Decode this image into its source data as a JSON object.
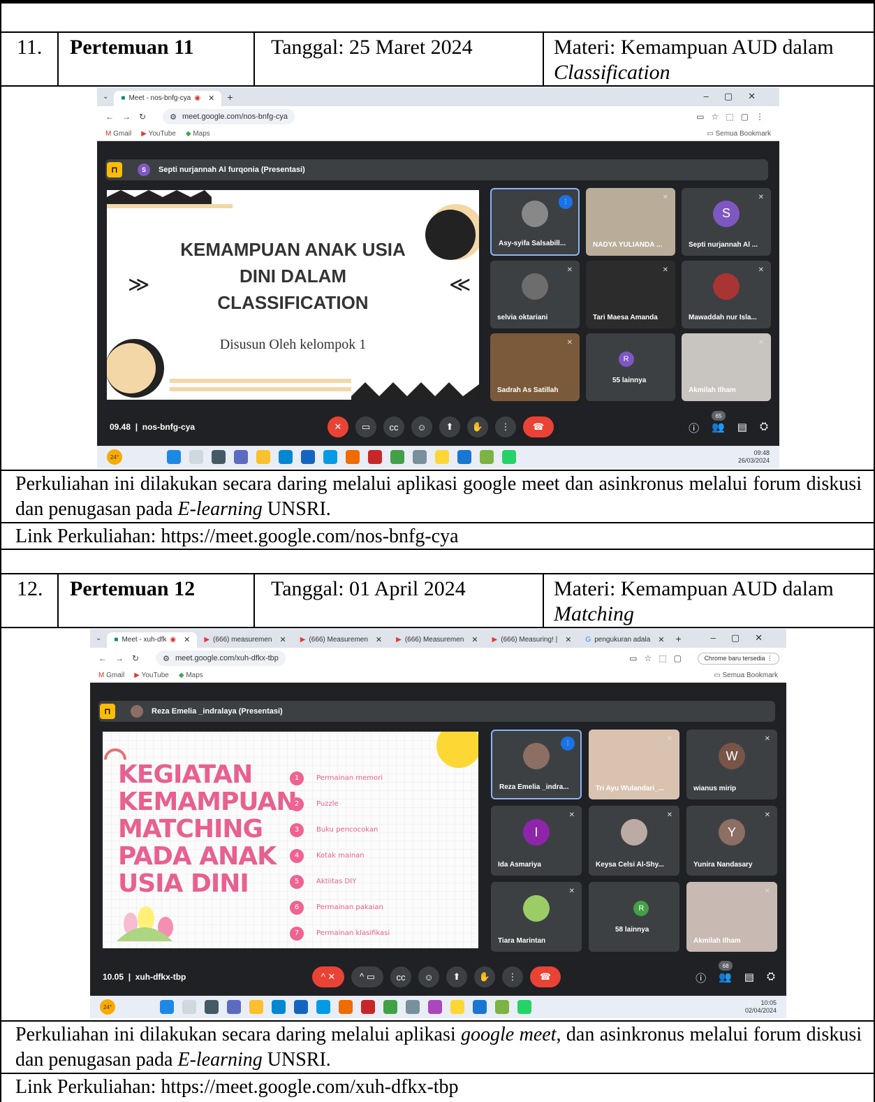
{
  "sessions": [
    {
      "number": "11.",
      "title": "Pertemuan 11",
      "date": "Tanggal: 25 Maret 2024",
      "materi_prefix": "Materi: Kemampuan AUD dalam",
      "materi_topic": "Classification",
      "desc_part1": "Perkuliahan ini dilakukan secara daring melalui aplikasi google meet dan asinkronus melalui forum diskusi dan penugasan pada ",
      "desc_italic": "E-learning",
      "desc_part2": " UNSRI.",
      "link": "Link Perkuliahan: https://meet.google.com/nos-bnfg-cya",
      "screenshot": {
        "tab_title": "Meet - nos-bnfg-cya",
        "url": "meet.google.com/nos-bnfg-cya",
        "bookmarks": [
          "Gmail",
          "YouTube",
          "Maps"
        ],
        "bookmark_folder": "Semua Bookmark",
        "presenter_initial": "S",
        "presenter": "Septi nurjannah Al furqonia (Presentasi)",
        "slide_title_lines": [
          "KEMAMPUAN ANAK USIA",
          "DINI DALAM",
          "CLASSIFICATION"
        ],
        "slide_subtitle": "Disusun Oleh kelompok 1",
        "participants": [
          "Asy-syifa Salsabill...",
          "NADYA YULIANDA ...",
          "Septi nurjannah Al ...",
          "selvia oktariani",
          "Tari Maesa Amanda",
          "Mawaddah nur Isla...",
          "Sadrah As Satillah",
          "55 lainnya",
          "Akmilah Ilham"
        ],
        "tile_initial": "S",
        "others_initial": "R",
        "time": "09.48",
        "meeting_code": "nos-bnfg-cya",
        "people_count": "65",
        "clock_time": "09:48",
        "clock_date": "26/03/2024",
        "weather": "24°"
      }
    },
    {
      "number": "12.",
      "title": "Pertemuan 12",
      "date": "Tanggal: 01 April 2024",
      "materi_prefix": "Materi: Kemampuan AUD dalam",
      "materi_topic": "Matching",
      "desc_part1": "Perkuliahan ini dilakukan secara daring melalui aplikasi ",
      "desc_italic1": "google meet",
      "desc_part2": ", dan asinkronus melalui forum diskusi dan penugasan pada ",
      "desc_italic2": "E-learning",
      "desc_part3": " UNSRI.",
      "link": "Link Perkuliahan: https://meet.google.com/xuh-dfkx-tbp",
      "screenshot": {
        "tabs": [
          "Meet - xuh-dfk",
          "(666) measuremen",
          "(666) Measuremen",
          "(666) Measuremen",
          "(666) Measuring! |",
          "pengukuran adala"
        ],
        "url": "meet.google.com/xuh-dfkx-tbp",
        "update_label": "Chrome baru tersedia",
        "bookmarks": [
          "Gmail",
          "YouTube",
          "Maps"
        ],
        "bookmark_folder": "Semua Bookmark",
        "presenter": "Reza Emelia _indralaya (Presentasi)",
        "slide_title_lines": [
          "KEGIATAN",
          "KEMAMPUAN",
          "MATCHING",
          "PADA ANAK",
          "USIA DINI"
        ],
        "slide_items": [
          "Permainan memori",
          "Puzzle",
          "Buku pencocokan",
          "Kotak mainan",
          "Aktiitas DIY",
          "Permainan pakaian",
          "Permainan klasifikasi"
        ],
        "participants": [
          "Reza Emelia _indra...",
          "Tri Ayu Wulandari_...",
          "wianus mirip",
          "Ida Asmariya",
          "Keysa Celsi Al-Shy...",
          "Yunira Nandasary",
          "Tiara Marintan",
          "58 lainnya",
          "Akmilah Ilham"
        ],
        "initials": {
          "w": "W",
          "i": "I",
          "y": "Y",
          "r": "R"
        },
        "time": "10.05",
        "meeting_code": "xuh-dfkx-tbp",
        "people_count": "68",
        "clock_time": "10:05",
        "clock_date": "02/04/2024",
        "weather": "24°"
      }
    }
  ],
  "colors": {
    "meet_bg": "#202124",
    "tile_bg": "#3c4043",
    "end_call": "#ea4335",
    "accent_blue": "#1a73e8",
    "slide2_pink": "#e8608f",
    "slide2_circle": "#f06292"
  }
}
